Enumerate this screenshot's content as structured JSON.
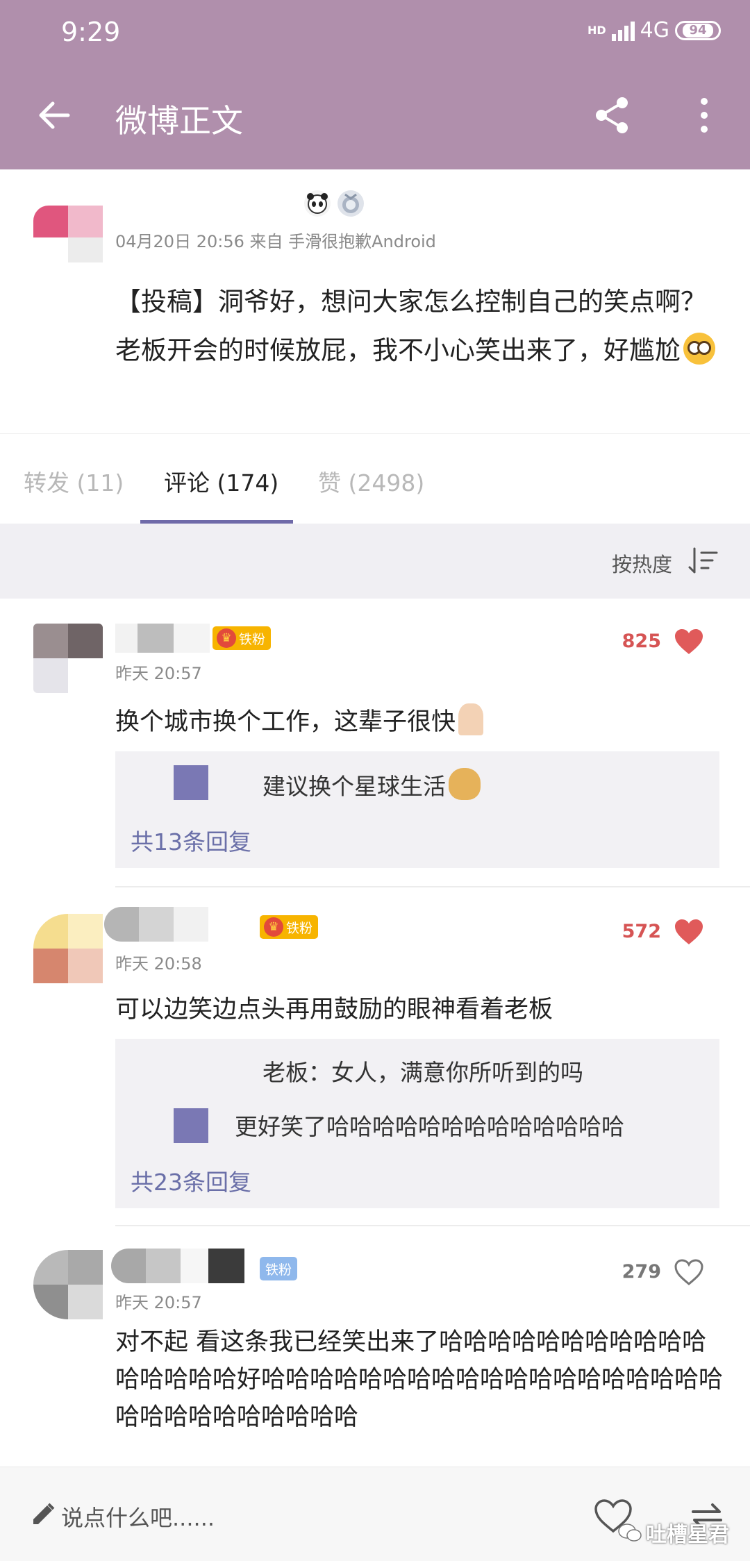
{
  "status_bar": {
    "time": "9:29",
    "hd": "HD",
    "network": "4G",
    "battery": "94"
  },
  "header": {
    "title": "微博正文"
  },
  "post": {
    "meta": "04月20日 20:56  来自 手滑很抱歉Android",
    "text": "【投稿】洞爷好，想问大家怎么控制自己的笑点啊？老板开会的时候放屁，我不小心笑出来了，好尴尬"
  },
  "tabs": {
    "repost": "转发 (11)",
    "comment": "评论 (174)",
    "like": "赞 (2498)"
  },
  "sort": {
    "label": "按热度"
  },
  "comments": [
    {
      "fan_badge": "铁粉",
      "time": "昨天 20:57",
      "likes": "825",
      "text": "换个城市换个工作，这辈子很快",
      "replies": [
        "建议换个星球生活"
      ],
      "more": "共13条回复"
    },
    {
      "fan_badge": "铁粉",
      "time": "昨天 20:58",
      "likes": "572",
      "text": "可以边笑边点头再用鼓励的眼神看着老板",
      "replies": [
        "老板：女人，满意你所听到的吗",
        "更好笑了哈哈哈哈哈哈哈哈哈哈哈哈哈"
      ],
      "more": "共23条回复"
    },
    {
      "fan_badge": "铁粉",
      "time": "昨天 20:57",
      "likes": "279",
      "text": "对不起 看这条我已经笑出来了哈哈哈哈哈哈哈哈哈哈哈哈哈哈哈哈好哈哈哈哈哈哈哈哈哈哈哈哈哈哈哈哈哈哈哈哈哈哈哈哈哈哈哈哈哈"
    }
  ],
  "bottom": {
    "placeholder": "说点什么吧......",
    "watermark": "吐槽星君"
  },
  "colors": {
    "header": "#b08fac",
    "accent": "#6f6aa8",
    "like_red": "#e05a5a"
  },
  "icons": [
    "back-arrow-icon",
    "share-icon",
    "more-vertical-icon",
    "sort-icon",
    "heart-icon",
    "edit-icon",
    "repost-icon"
  ]
}
